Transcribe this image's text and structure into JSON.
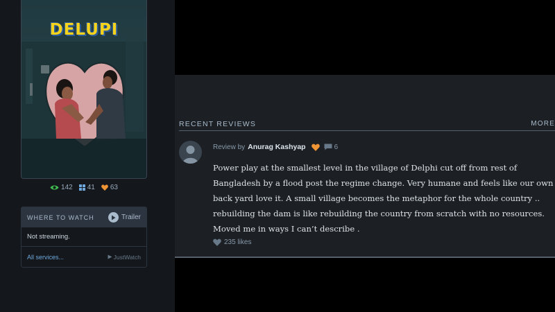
{
  "poster": {
    "title_text": "DELUPI"
  },
  "stats": {
    "watched": "142",
    "lists": "41",
    "likes": "63"
  },
  "where_to_watch": {
    "title": "WHERE TO WATCH",
    "trailer_label": "Trailer",
    "status": "Not streaming.",
    "all_services": "All services...",
    "provider": "JustWatch"
  },
  "reviews": {
    "section_title": "RECENT REVIEWS",
    "more_label": "MORE",
    "items": [
      {
        "review_by": "Review by",
        "author": "Anurag Kashyap",
        "liked": true,
        "comment_count": "6",
        "body": "Power play at the smallest level in the village of Delphi cut off from rest of Bangladesh by a flood post the regime change. Very humane and feels like our own back yard love it. A small village becomes the metaphor for the whole country .. rebuilding the dam is like rebuilding the country from scratch with no resources. Moved me in ways I can’t describe .",
        "likes": "235 likes"
      }
    ]
  },
  "colors": {
    "left_bg": "#14181c",
    "panel_bg": "#1c2024",
    "watched_green": "#40bc4f",
    "like_orange": "#f09535",
    "text_muted": "#8899aa"
  },
  "icons": [
    "eye-icon",
    "grid-icon",
    "heart-icon",
    "play-icon",
    "comment-icon",
    "justwatch-icon"
  ]
}
